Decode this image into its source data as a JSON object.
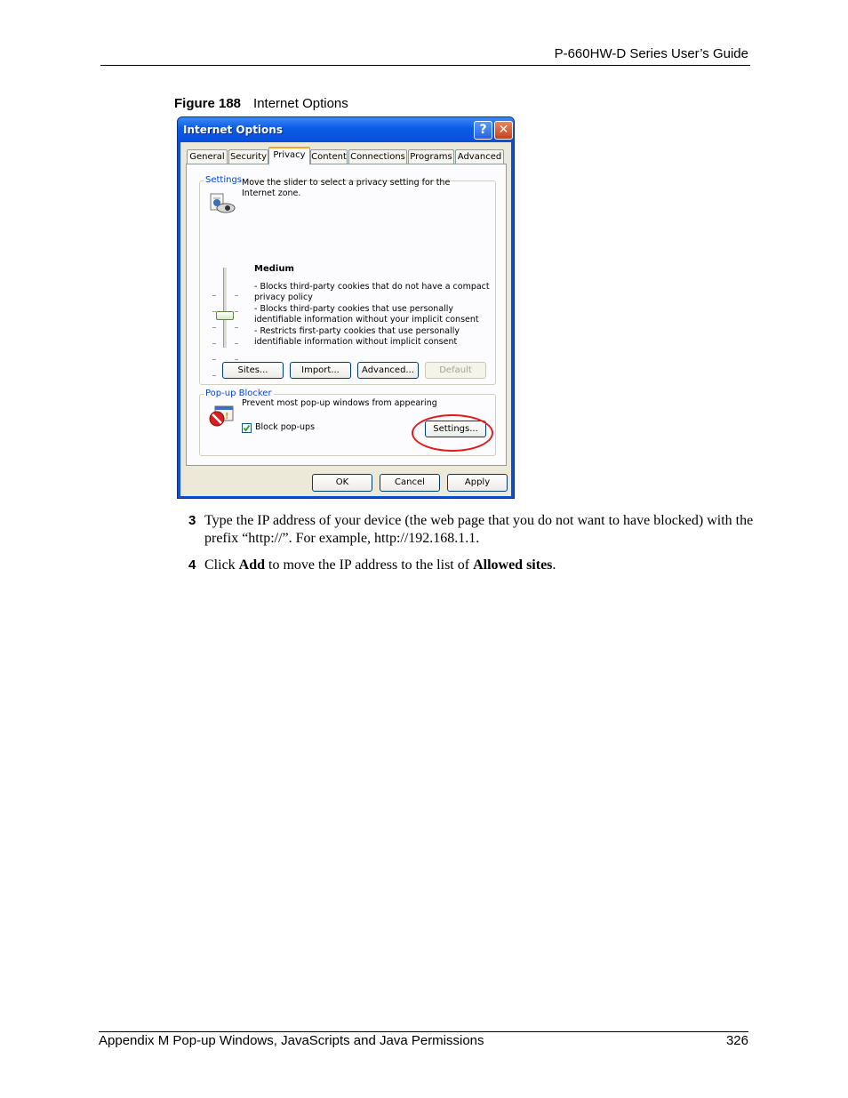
{
  "page_header": {
    "title": "P-660HW-D Series User’s Guide"
  },
  "figure": {
    "label": "Figure 188",
    "title": "Internet Options"
  },
  "dialog": {
    "title": "Internet Options",
    "help_glyph": "?",
    "close_glyph": "✕",
    "tabs": [
      "General",
      "Security",
      "Privacy",
      "Content",
      "Connections",
      "Programs",
      "Advanced"
    ],
    "active_tab": "Privacy",
    "settings_group": {
      "label": "Settings",
      "instruction": "Move the slider to select a privacy setting for the Internet zone.",
      "level": "Medium",
      "rules": [
        "- Blocks third-party cookies that do not have a compact privacy policy",
        "- Blocks third-party cookies that use personally identifiable information without your implicit consent",
        "- Restricts first-party cookies that use personally identifiable information without implicit consent"
      ],
      "buttons": {
        "sites": "Sites...",
        "import": "Import...",
        "advanced": "Advanced...",
        "default": "Default"
      }
    },
    "popup_group": {
      "label": "Pop-up Blocker",
      "description": "Prevent most pop-up windows from appearing",
      "checkbox_label": "Block pop-ups",
      "checkbox_checked": true,
      "settings_button": "Settings..."
    },
    "footer_buttons": {
      "ok": "OK",
      "cancel": "Cancel",
      "apply": "Apply"
    }
  },
  "steps": [
    {
      "number": "3",
      "text": "Type the IP address of your device (the web page that you do not want to have blocked) with the prefix “http://”. For example, http://192.168.1.1."
    },
    {
      "number": "4",
      "pre": "Click ",
      "bold1": "Add",
      "mid": " to move the IP address to the list of ",
      "bold2": "Allowed sites",
      "post": "."
    }
  ],
  "page_footer": {
    "left": "Appendix M Pop-up Windows, JavaScripts and Java Permissions",
    "right": "326"
  }
}
